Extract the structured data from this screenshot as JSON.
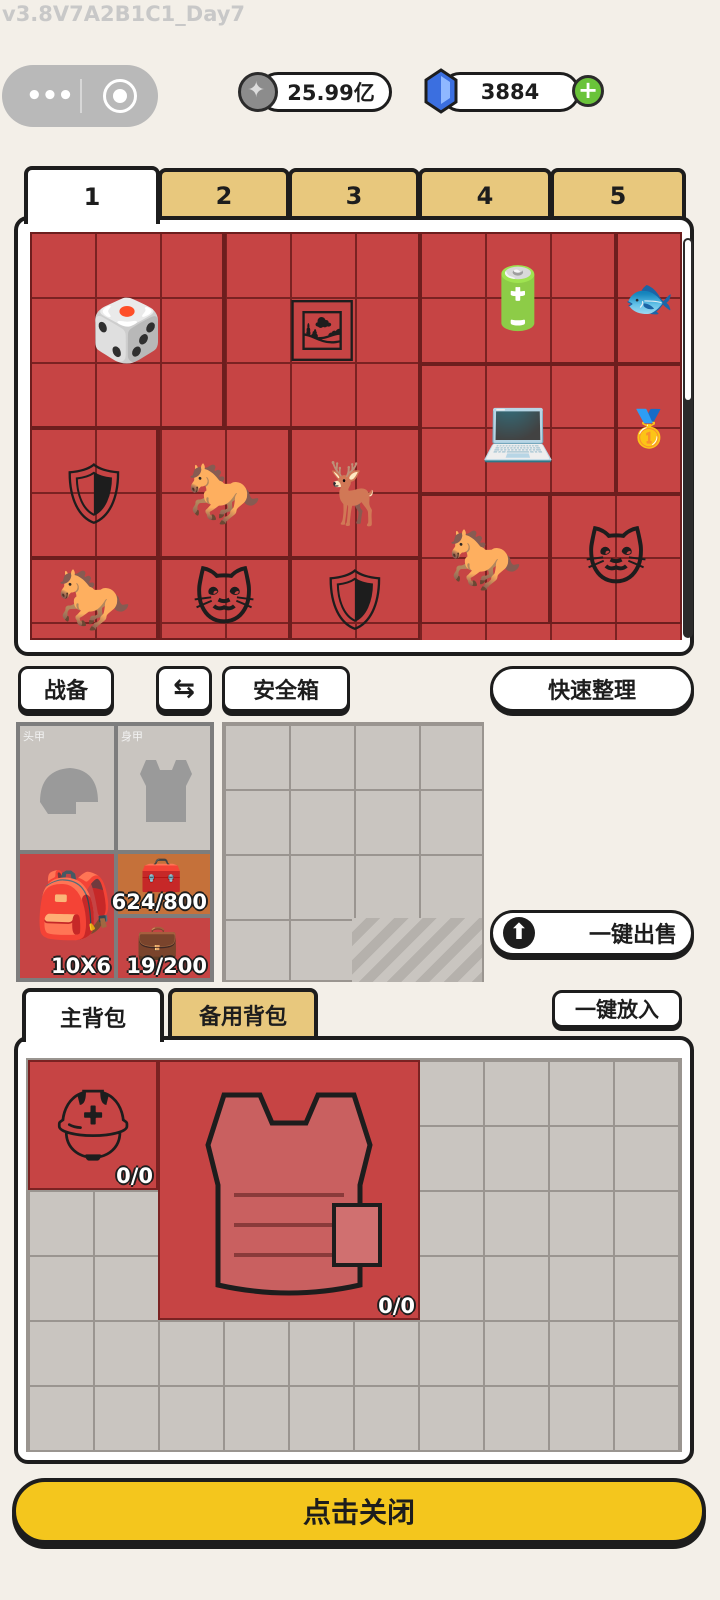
{
  "version_text": "v3.8V7A2B1C1_Day7",
  "capsule": {
    "menu_icon": "more-dots-icon",
    "close_icon": "target-icon"
  },
  "currency": {
    "coins": "25.99亿",
    "gems": "3884",
    "coin_icon": "coin-icon",
    "gem_icon": "crystal-icon",
    "add_icon": "plus-icon"
  },
  "storage_tabs": [
    "1",
    "2",
    "3",
    "4",
    "5"
  ],
  "storage_items": [
    {
      "name": "go-board-icon",
      "glyph": "🎲"
    },
    {
      "name": "framed-painting-icon",
      "glyph": "🖼"
    },
    {
      "name": "battery-pack-icon",
      "glyph": "🔋"
    },
    {
      "name": "koi-statue-icon",
      "glyph": "🐟"
    },
    {
      "name": "laptop-icon",
      "glyph": "💻"
    },
    {
      "name": "gold-bar-icon",
      "glyph": "🥇"
    },
    {
      "name": "lion-disc-icon",
      "glyph": "🛡"
    },
    {
      "name": "jade-horse-icon",
      "glyph": "🐎"
    },
    {
      "name": "golden-deer-icon",
      "glyph": "🦌"
    },
    {
      "name": "jade-horse-icon",
      "glyph": "🐎"
    },
    {
      "name": "cat-figurine-icon",
      "glyph": "🐱"
    },
    {
      "name": "jade-horse-icon",
      "glyph": "🐎"
    },
    {
      "name": "cat-figurine-icon",
      "glyph": "🐱"
    },
    {
      "name": "lion-disc-icon",
      "glyph": "🛡"
    }
  ],
  "buttons": {
    "gear": "战备",
    "swap_icon": "swap-arrows-icon",
    "safe_box": "安全箱",
    "quick_sort": "快速整理",
    "sell_all": "一键出售",
    "sell_icon": "upload-arrow-icon",
    "put_all": "一键放入",
    "close": "点击关闭"
  },
  "equipment": {
    "helmet_label": "头甲",
    "armor_label": "身甲",
    "backpack_size": "10X6",
    "chest_rig_count": "624/800",
    "case_count": "19/200"
  },
  "backpack_tabs": [
    "主背包",
    "备用背包"
  ],
  "backpack_items": {
    "helmet_durability": "0/0",
    "vest_durability": "0/0"
  }
}
